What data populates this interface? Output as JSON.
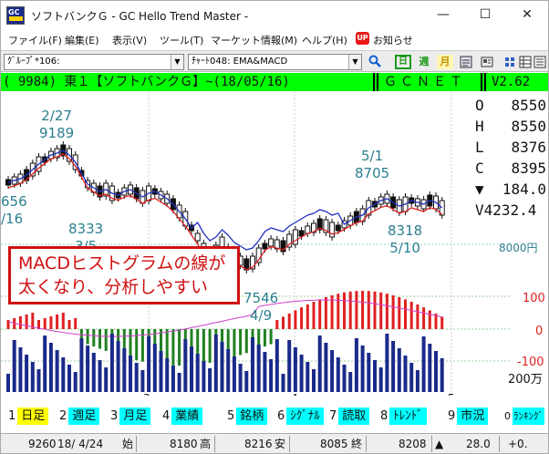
{
  "window": {
    "title": "ソフトバンクＧ - GC Hello Trend Master -",
    "minimize": "—",
    "maximize": "☐",
    "close": "✕",
    "app_icon": "GC"
  },
  "menu": [
    "ファイル(F)",
    "編集(E)",
    "表示(V)",
    "ツール(T)",
    "マーケット情報(M)",
    "ヘルプ(H)"
  ],
  "notice": {
    "badge": "UP",
    "label": "お知らせ"
  },
  "toolbar": {
    "group_select": "ｸﾞﾙｰﾌﾟ*106:",
    "chart_select": "ﾁｬｰﾄ048: EMA&MACD",
    "icons": [
      "search-icon",
      "daily-icon",
      "weekly-icon",
      "monthly-icon",
      "report-icon",
      "news-icon",
      "settings-icon",
      "grid-icon",
      "list-icon"
    ],
    "daily_glyph": "日",
    "weekly_glyph": "週",
    "monthly_glyph": "月"
  },
  "status_line": {
    "segments": [
      "( 9984) 東１【ソフトバンクＧ】~(18/05/16)",
      "ＧＣＮＥＴ",
      "V2.62"
    ]
  },
  "ohlc": {
    "O": "8550",
    "H": "8550",
    "L": "8376",
    "C": "8395",
    "change": "184.0",
    "volume": "V4232.4"
  },
  "annotations": {
    "high_date": "2/27",
    "high_price": "9189",
    "low1_price": "8333",
    "low1_date": "3/5",
    "peak2_date": "5/1",
    "peak2_price": "8705",
    "low2_price": "8318",
    "low2_date": "5/10",
    "bottom_price": "7546",
    "bottom_date": "4/9",
    "left_price": "656",
    "left_date": "/16"
  },
  "axis": {
    "price_level": "8000円",
    "macd_top": "100",
    "macd_zero": "0",
    "macd_bottom": "-100",
    "volume_label": "200万",
    "month_labels": [
      "3",
      "4",
      "5"
    ]
  },
  "callout": {
    "line1": "MACDヒストグラムの線が",
    "line2": "太くなり、分析しやすい"
  },
  "tabs": [
    {
      "num": "1",
      "label": "日足",
      "active": true
    },
    {
      "num": "2",
      "label": "週足",
      "active": false
    },
    {
      "num": "3",
      "label": "月足",
      "active": false
    },
    {
      "num": "4",
      "label": "業績",
      "active": false
    },
    {
      "num": "5",
      "label": "銘柄",
      "active": false
    },
    {
      "num": "6",
      "label": "ｼｸﾞﾅﾙ",
      "active": false
    },
    {
      "num": "7",
      "label": "読取",
      "active": false
    },
    {
      "num": "8",
      "label": "ﾄﾚﾝﾄﾞ",
      "active": false
    },
    {
      "num": "9",
      "label": "市況",
      "active": false
    },
    {
      "num": "0",
      "label": "ﾗﾝｷﾝｸﾞ",
      "active": false
    }
  ],
  "bottom": {
    "code": "9260",
    "date": "18/ 4/24",
    "open_label": "始",
    "open": "8180",
    "high_label": "高",
    "high": "8216",
    "low_label": "安",
    "low": "8085",
    "close_label": "終",
    "close": "8208",
    "change": "28.0",
    "pct": "+0."
  },
  "colors": {
    "candle": "#111111",
    "ema_short": "#e02020",
    "ema_long": "#2030c0",
    "hist_pos": "#e02020",
    "hist_neg": "#208020",
    "macd_line": "#d040d0",
    "volume": "#1a2a8a",
    "annotation": "#2a7f8f",
    "status_bg": "#00ff00",
    "tab_bg": "#00ffff",
    "tab_active_bg": "#ffff00"
  }
}
